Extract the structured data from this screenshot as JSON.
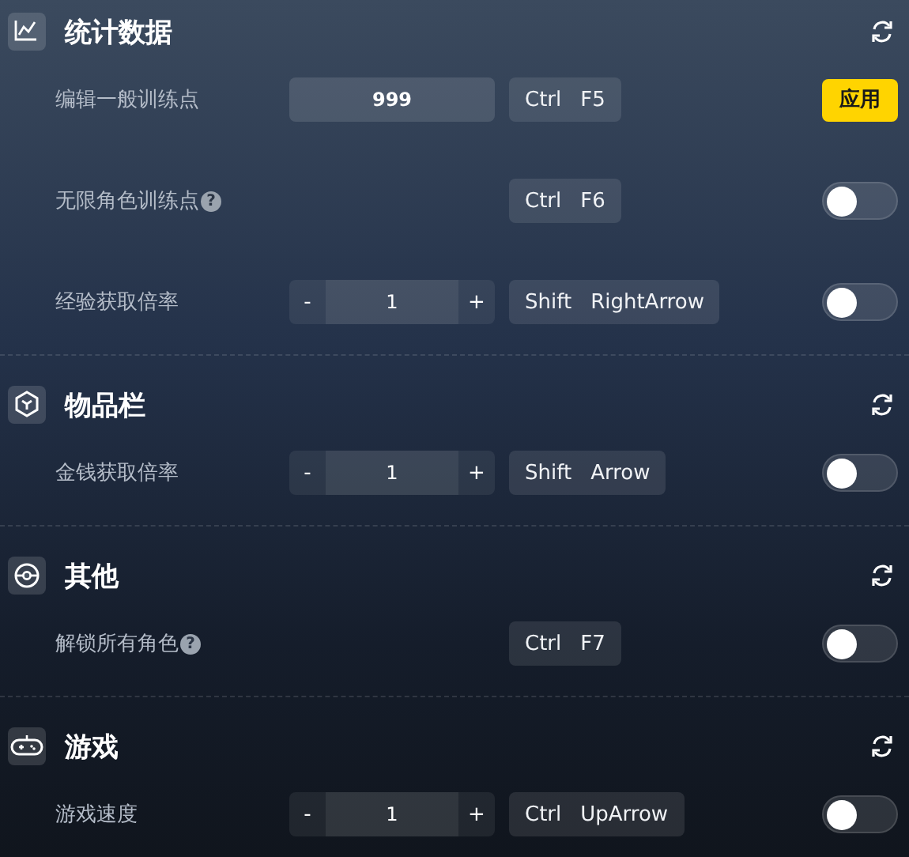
{
  "sections": [
    {
      "title": "统计数据",
      "rows": [
        {
          "label": "编辑一般训练点",
          "control": {
            "kind": "input",
            "value": "999"
          },
          "hotkey": [
            "Ctrl",
            "F5"
          ],
          "action": {
            "kind": "button",
            "label": "应用"
          }
        },
        {
          "label": "无限角色训练点",
          "hint": "?",
          "hotkey": [
            "Ctrl",
            "F6"
          ],
          "action": {
            "kind": "toggle",
            "on": false
          }
        },
        {
          "label": "经验获取倍率",
          "control": {
            "kind": "stepper",
            "minus": "-",
            "value": "1",
            "plus": "+"
          },
          "hotkey": [
            "Shift",
            "RightArrow"
          ],
          "action": {
            "kind": "toggle",
            "on": false
          }
        }
      ]
    },
    {
      "title": "物品栏",
      "rows": [
        {
          "label": "金钱获取倍率",
          "control": {
            "kind": "stepper",
            "minus": "-",
            "value": "1",
            "plus": "+"
          },
          "hotkey": [
            "Shift",
            "Arrow"
          ],
          "action": {
            "kind": "toggle",
            "on": false
          }
        }
      ]
    },
    {
      "title": "其他",
      "rows": [
        {
          "label": "解锁所有角色",
          "hint": "?",
          "hotkey": [
            "Ctrl",
            "F7"
          ],
          "action": {
            "kind": "toggle",
            "on": false
          }
        }
      ]
    },
    {
      "title": "游戏",
      "rows": [
        {
          "label": "游戏速度",
          "control": {
            "kind": "stepper",
            "minus": "-",
            "value": "1",
            "plus": "+"
          },
          "hotkey": [
            "Ctrl",
            "UpArrow"
          ],
          "action": {
            "kind": "toggle",
            "on": false
          }
        }
      ]
    }
  ]
}
